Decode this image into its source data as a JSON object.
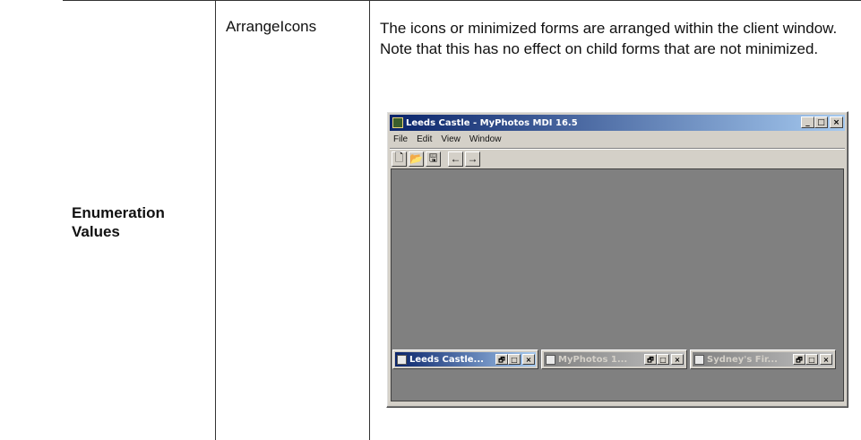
{
  "table": {
    "row_label": "Enumeration Values",
    "value_name": "ArrangeIcons",
    "description": "The icons or minimized forms are arranged within the client window. Note that this has no effect on child forms that are not minimized."
  },
  "window": {
    "title": "Leeds Castle - MyPhotos MDI 16.5",
    "menus": [
      "File",
      "Edit",
      "View",
      "Window"
    ],
    "toolbar": [
      {
        "icon": "new-document-icon",
        "glyph": "🗋"
      },
      {
        "icon": "open-folder-icon",
        "glyph": "📂"
      },
      {
        "icon": "save-icon",
        "glyph": "🖫"
      },
      {
        "icon": "back-arrow-icon",
        "glyph": "←"
      },
      {
        "icon": "forward-arrow-icon",
        "glyph": "→"
      }
    ],
    "caption_buttons": {
      "minimize": "_",
      "maximize": "□",
      "close": "×"
    },
    "minimized_children": [
      {
        "title": "Leeds Castle...",
        "active": true
      },
      {
        "title": "MyPhotos 1...",
        "active": false
      },
      {
        "title": "Sydney's Fir...",
        "active": false
      }
    ],
    "mini_caption_buttons": {
      "restore": "🗗",
      "maximize": "□",
      "close": "×"
    }
  }
}
